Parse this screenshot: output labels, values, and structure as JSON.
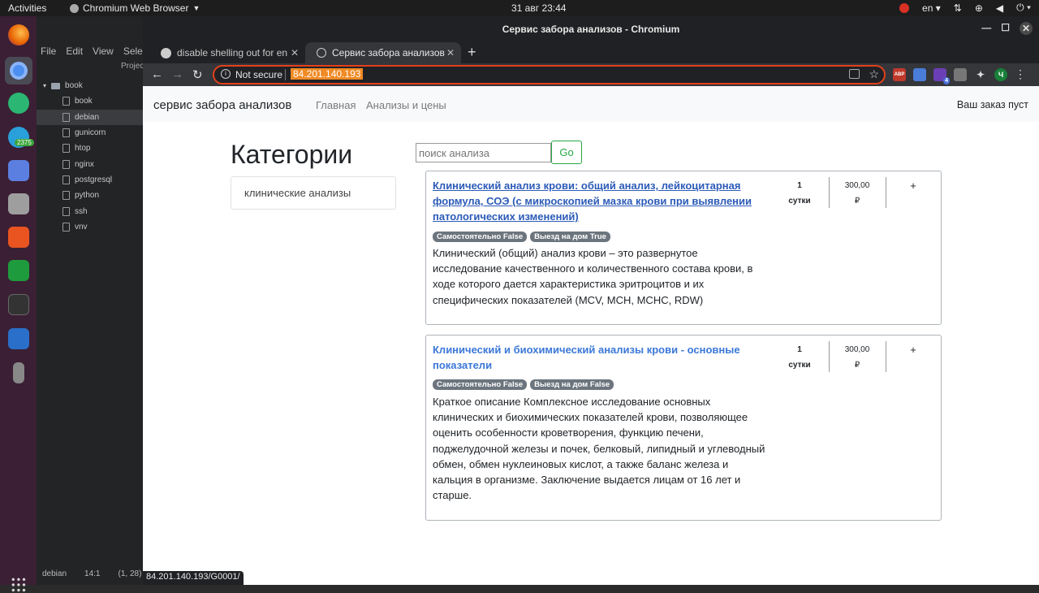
{
  "topbar": {
    "activities": "Activities",
    "app_menu": "Chromium Web Browser",
    "clock": "31 авг  23:44",
    "lang": "en"
  },
  "dock": {
    "telegram_badge": "2375"
  },
  "editor": {
    "menu": [
      "File",
      "Edit",
      "View",
      "Selec"
    ],
    "project_label": "Projec",
    "root_folder": "book",
    "files": [
      "book",
      "debian",
      "gunicorn",
      "htop",
      "nginx",
      "postgresql",
      "python",
      "ssh",
      "vnv"
    ],
    "selected_file": "debian",
    "status": {
      "file": "debian",
      "line_col": "14:1",
      "pos": "(1, 28)"
    }
  },
  "browser": {
    "window_title": "Сервис забора анализов - Chromium",
    "tabs": [
      {
        "label": "disable shelling out for en"
      },
      {
        "label": "Сервис забора анализов"
      }
    ],
    "omnibox": {
      "security": "Not secure",
      "url": "84.201.140.193"
    },
    "extensions": {
      "abp": "ABP",
      "badge": "4",
      "avatar": "Ч"
    },
    "status_url": "84.201.140.193/G0001/"
  },
  "page": {
    "brand": "сервис забора анализов",
    "nav": [
      "Главная",
      "Анализы и цены"
    ],
    "cart": "Ваш заказ пуст",
    "categories_title": "Категории",
    "categories": [
      "клинические анализы"
    ],
    "search": {
      "placeholder": "поиск анализа",
      "button": "Go"
    },
    "products": [
      {
        "title": "Клинический анализ крови: общий анализ, лейкоцитарная формула, СОЭ (с микроскопией мазка крови при выявлении патологических изменений)",
        "badges": [
          "Самостоятельно False",
          "Выезд на дом True"
        ],
        "description": "Клинический (общий) анализ крови – это развернутое исследование качественного и количественного состава крови, в ходе которого дается характеристика эритроцитов и их специфических показателей (MCV, MCH, MCHC, RDW)",
        "duration_value": "1",
        "duration_unit": "сутки",
        "price": "300,00",
        "currency": "₽",
        "add": "+"
      },
      {
        "title": "Клинический и биохимический анализы крови - основные показатели",
        "badges": [
          "Самостоятельно False",
          "Выезд на дом False"
        ],
        "description": "Краткое описание Комплексное исследование основных клинических и биохимических показателей крови, позволяющее оценить особенности кроветворения, функцию печени, поджелудочной железы и почек, белковый, липидный и углеводный обмен, обмен нуклеиновых кислот, а также баланс железа и кальция в организме. Заключение выдается лицам от 16 лет и старше.",
        "duration_value": "1",
        "duration_unit": "сутки",
        "price": "300,00",
        "currency": "₽",
        "add": "+"
      }
    ]
  }
}
